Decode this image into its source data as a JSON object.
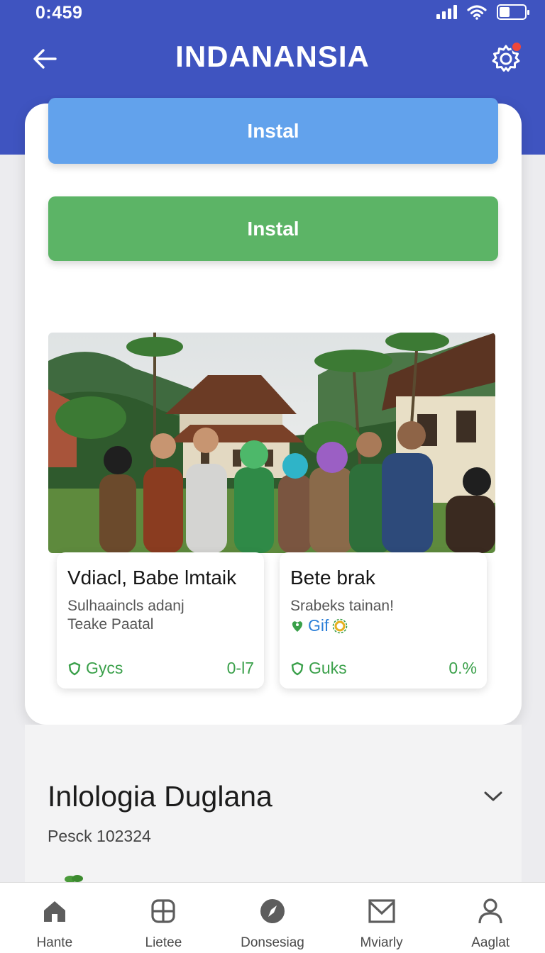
{
  "status_bar": {
    "time": "0:459"
  },
  "app_bar": {
    "title": "INDANANSIA"
  },
  "buttons": {
    "primary": "Instal",
    "secondary": "Instal"
  },
  "colors": {
    "header": "#3f54c0",
    "button_blue": "#62a2ec",
    "button_green": "#5cb466",
    "accent_green": "#3aa04a",
    "notification": "#f0473a"
  },
  "cards": [
    {
      "title": "Vdiacl, Babe lmtaik",
      "line1": "Sulhaaincls adanj",
      "line2": "Teake Paatal",
      "tag": "Gycs",
      "value": "0-l7"
    },
    {
      "title": "Bete brak",
      "line1": "Srabeks tainan!",
      "gif_label": "Gif",
      "tag": "Guks",
      "value": "0.%"
    }
  ],
  "section": {
    "title": "Inlologia Duglana",
    "subtitle": "Pesck 102324"
  },
  "bottom_nav": [
    {
      "label": "Hante",
      "icon": "home-icon"
    },
    {
      "label": "Lietee",
      "icon": "grid-icon"
    },
    {
      "label": "Donsesiag",
      "icon": "compass-icon"
    },
    {
      "label": "Mviarly",
      "icon": "mail-icon"
    },
    {
      "label": "Aaglat",
      "icon": "profile-icon"
    }
  ]
}
